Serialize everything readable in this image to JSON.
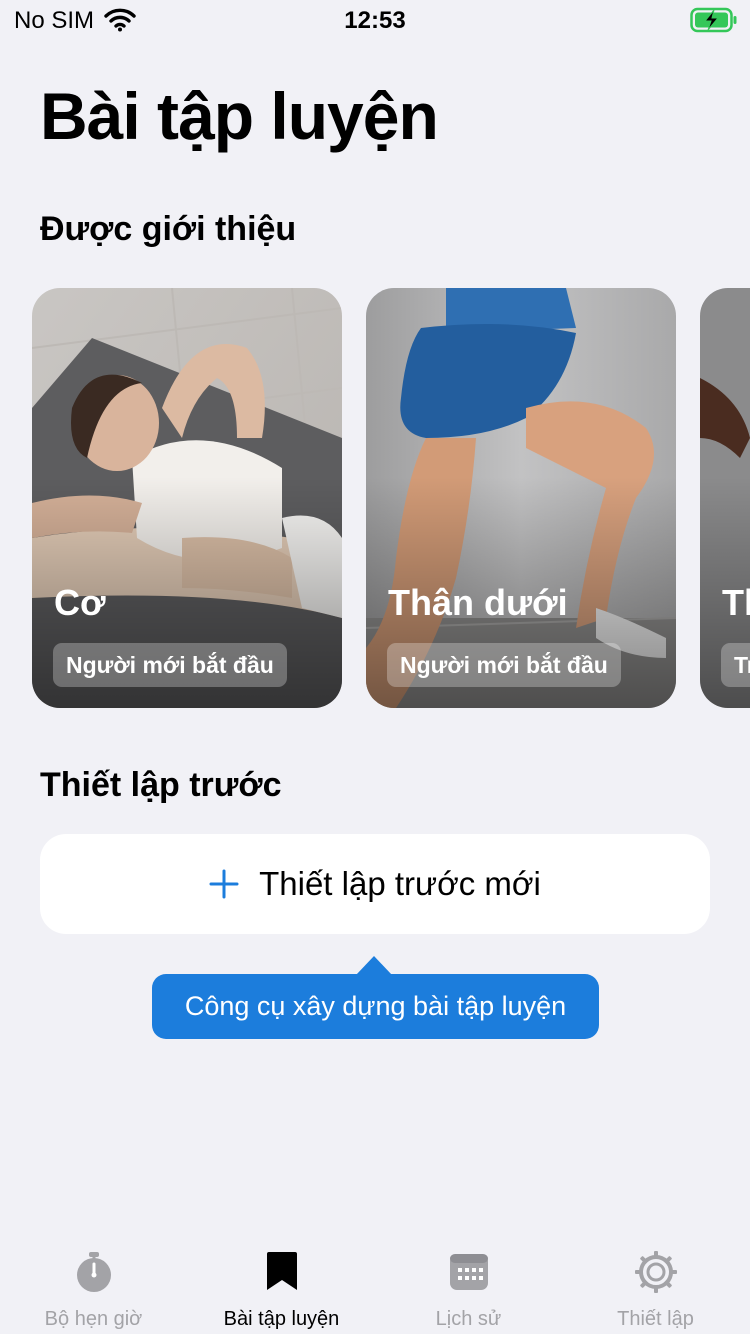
{
  "status_bar": {
    "carrier": "No SIM",
    "time": "12:53"
  },
  "page_title": "Bài tập luyện",
  "featured": {
    "title": "Được giới thiệu",
    "cards": [
      {
        "title": "Cơ",
        "level": "Người mới bắt đầu"
      },
      {
        "title": "Thân dưới",
        "level": "Người mới bắt đầu"
      },
      {
        "title": "Th",
        "level": "Tr"
      }
    ]
  },
  "presets": {
    "title": "Thiết lập trước",
    "new_label": "Thiết lập trước mới"
  },
  "tooltip": {
    "text": "Công cụ xây dựng bài tập luyện"
  },
  "tab_bar": {
    "items": [
      {
        "label": "Bộ hẹn giờ",
        "icon": "stopwatch-icon"
      },
      {
        "label": "Bài tập luyện",
        "icon": "bookmark-icon",
        "active": true
      },
      {
        "label": "Lịch sử",
        "icon": "calendar-icon"
      },
      {
        "label": "Thiết lập",
        "icon": "gear-icon"
      }
    ]
  },
  "colors": {
    "accent": "#1c7ddc",
    "background": "#f1f1f6",
    "battery": "#34c759",
    "inactive": "#a3a3a7"
  }
}
